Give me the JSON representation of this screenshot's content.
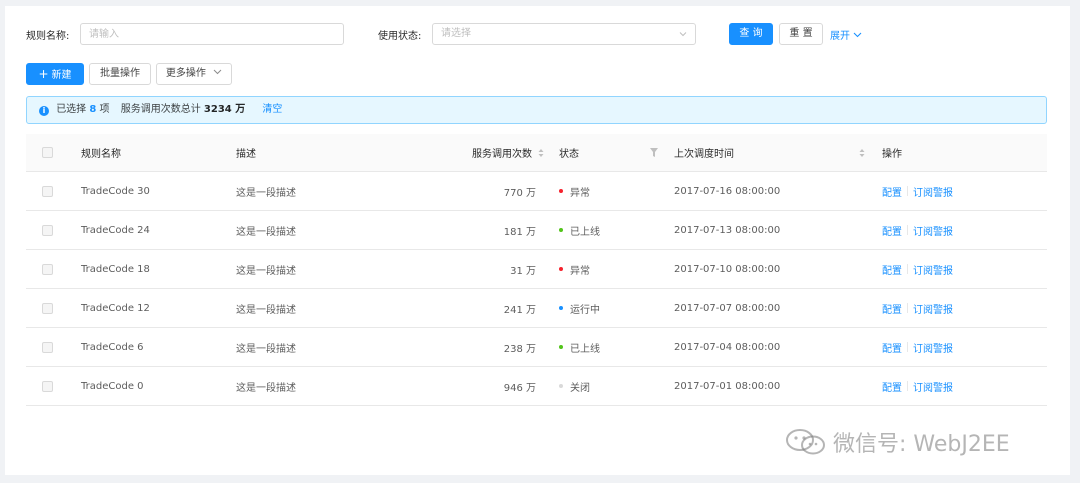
{
  "search": {
    "rule_name_label": "规则名称:",
    "rule_name_placeholder": "请输入",
    "status_label": "使用状态:",
    "status_placeholder": "请选择",
    "query_button": "查 询",
    "reset_button": "重 置",
    "expand_link": "展开"
  },
  "toolbar": {
    "new_button": "新建",
    "batch_button": "批量操作",
    "more_button": "更多操作"
  },
  "alert": {
    "selected_prefix": "已选择",
    "selected_count": "8",
    "selected_suffix": "项",
    "total_prefix": "服务调用次数总计",
    "total_value": "3234 万",
    "clear_link": "清空"
  },
  "table": {
    "columns": {
      "name": "规则名称",
      "desc": "描述",
      "calls": "服务调用次数",
      "status": "状态",
      "updated": "上次调度时间",
      "actions": "操作"
    },
    "rows": [
      {
        "name": "TradeCode 30",
        "desc": "这是一段描述",
        "calls": "770 万",
        "status": "异常",
        "status_color": "#f5222d",
        "updated": "2017-07-16 08:00:00",
        "action1": "配置",
        "action2": "订阅警报"
      },
      {
        "name": "TradeCode 24",
        "desc": "这是一段描述",
        "calls": "181 万",
        "status": "已上线",
        "status_color": "#52c41a",
        "updated": "2017-07-13 08:00:00",
        "action1": "配置",
        "action2": "订阅警报"
      },
      {
        "name": "TradeCode 18",
        "desc": "这是一段描述",
        "calls": "31 万",
        "status": "异常",
        "status_color": "#f5222d",
        "updated": "2017-07-10 08:00:00",
        "action1": "配置",
        "action2": "订阅警报"
      },
      {
        "name": "TradeCode 12",
        "desc": "这是一段描述",
        "calls": "241 万",
        "status": "运行中",
        "status_color": "#1890ff",
        "updated": "2017-07-07 08:00:00",
        "action1": "配置",
        "action2": "订阅警报"
      },
      {
        "name": "TradeCode 6",
        "desc": "这是一段描述",
        "calls": "238 万",
        "status": "已上线",
        "status_color": "#52c41a",
        "updated": "2017-07-04 08:00:00",
        "action1": "配置",
        "action2": "订阅警报"
      },
      {
        "name": "TradeCode 0",
        "desc": "这是一段描述",
        "calls": "946 万",
        "status": "关闭",
        "status_color": "#d9d9d9",
        "updated": "2017-07-01 08:00:00",
        "action1": "配置",
        "action2": "订阅警报"
      }
    ]
  },
  "watermark": {
    "text": "微信号: WebJ2EE"
  },
  "colors": {
    "primary": "#1890ff",
    "error": "#f5222d",
    "success": "#52c41a",
    "default": "#d9d9d9"
  }
}
